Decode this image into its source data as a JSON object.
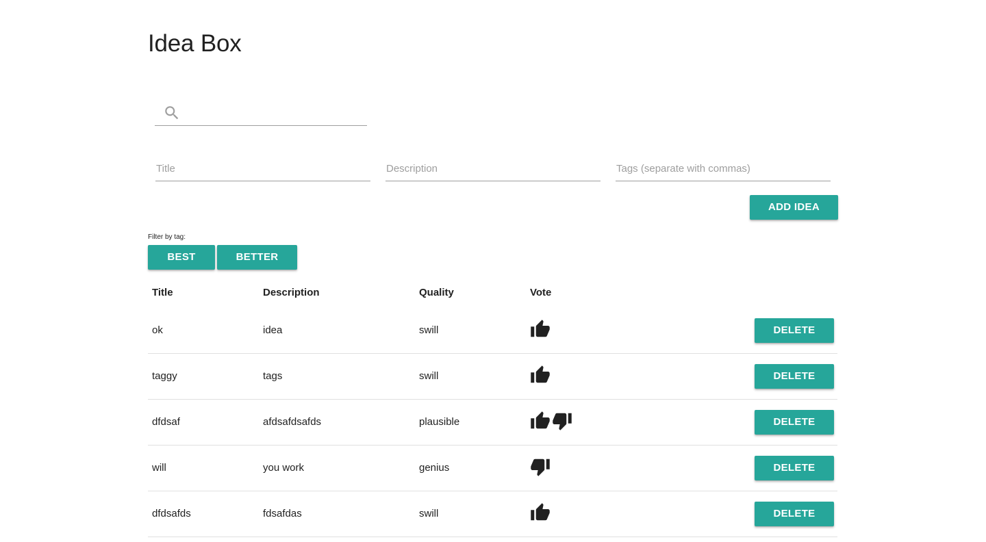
{
  "app": {
    "title": "Idea Box"
  },
  "search": {
    "value": "",
    "placeholder": "",
    "icon": "search-icon"
  },
  "form": {
    "title_placeholder": "Title",
    "description_placeholder": "Description",
    "tags_placeholder": "Tags (separate with commas)",
    "add_label": "ADD IDEA"
  },
  "filter": {
    "label": "Filter by tag:",
    "tags": [
      "BEST",
      "BETTER"
    ]
  },
  "table": {
    "headers": {
      "title": "Title",
      "description": "Description",
      "quality": "Quality",
      "vote": "Vote"
    },
    "rows": [
      {
        "title": "ok",
        "description": "idea",
        "quality": "swill",
        "votes": [
          "thumbs-up-icon"
        ],
        "delete_label": "DELETE"
      },
      {
        "title": "taggy",
        "description": "tags",
        "quality": "swill",
        "votes": [
          "thumbs-up-icon"
        ],
        "delete_label": "DELETE"
      },
      {
        "title": "dfdsaf",
        "description": "afdsafdsafds",
        "quality": "plausible",
        "votes": [
          "thumbs-up-icon",
          "thumbs-down-icon"
        ],
        "delete_label": "DELETE"
      },
      {
        "title": "will",
        "description": "you work",
        "quality": "genius",
        "votes": [
          "thumbs-down-icon"
        ],
        "delete_label": "DELETE"
      },
      {
        "title": "dfdsafds",
        "description": "fdsafdas",
        "quality": "swill",
        "votes": [
          "thumbs-up-icon"
        ],
        "delete_label": "DELETE"
      }
    ]
  },
  "colors": {
    "accent": "#26a69a",
    "text": "#212121",
    "divider": "#e0e0e0",
    "placeholder": "#9e9e9e"
  }
}
